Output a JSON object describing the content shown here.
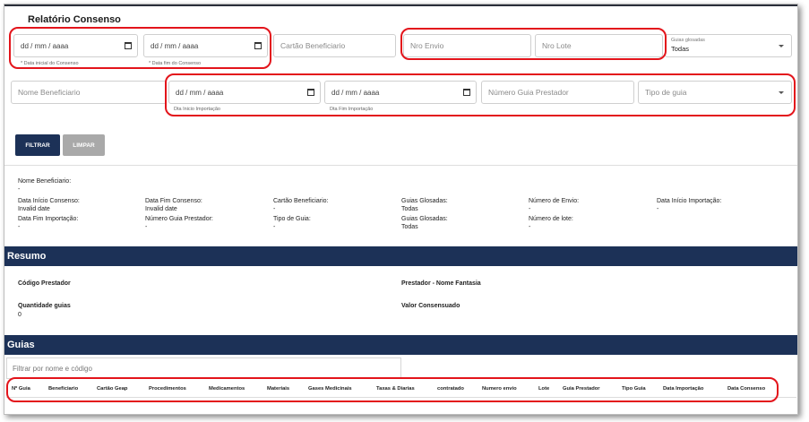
{
  "page": {
    "title": "Relatório Consenso"
  },
  "filters": {
    "data_inicial_consenso": {
      "value": "dd / mm / aaaa",
      "helper": "* Data inicial do Consenso"
    },
    "data_fim_consenso": {
      "value": "dd / mm / aaaa",
      "helper": "* Data fim do Consenso"
    },
    "cartao_beneficiario": {
      "placeholder": "Cartão Beneficiario"
    },
    "nro_envio": {
      "placeholder": "Nro Envio"
    },
    "nro_lote": {
      "placeholder": "Nro Lote"
    },
    "guias_glosadas": {
      "label": "Guias glosadas",
      "value": "Todas"
    },
    "nome_beneficiario": {
      "placeholder": "Nome Beneficiario"
    },
    "data_inicio_importacao": {
      "value": "dd / mm / aaaa",
      "helper": "Dta Inicio Importação"
    },
    "data_fim_importacao": {
      "value": "dd / mm / aaaa",
      "helper": "Dta Fim Importação"
    },
    "numero_guia_prestador": {
      "placeholder": "Número Guia Prestador"
    },
    "tipo_de_guia": {
      "placeholder": "Tipo de guia"
    }
  },
  "actions": {
    "filtrar": "FILTRAR",
    "limpar": "LIMPAR"
  },
  "filter_summary": {
    "nome_beneficiario_label": "Nome Beneficiario:",
    "nome_beneficiario_value": "-",
    "row1": [
      {
        "label": "Data Início Consenso:",
        "value": "Invalid date"
      },
      {
        "label": "Data Fim Consenso:",
        "value": "Invalid date"
      },
      {
        "label": "Cartão Beneficiario:",
        "value": "-"
      },
      {
        "label": "Guias Glosadas:",
        "value": "Todas"
      },
      {
        "label": "Número de Envio:",
        "value": "-"
      },
      {
        "label": "Data Início Importação:",
        "value": "-"
      }
    ],
    "row2": [
      {
        "label": "Data Fim Importação:",
        "value": "-"
      },
      {
        "label": "Número Guia Prestador:",
        "value": "-"
      },
      {
        "label": "Tipo de Guia:",
        "value": "-"
      },
      {
        "label": "Guias Glosadas:",
        "value": "Todas"
      },
      {
        "label": "Número de lote:",
        "value": "-"
      }
    ]
  },
  "resumo": {
    "title": "Resumo",
    "codigo_prestador_label": "Código Prestador",
    "prestador_nome_label": "Prestador - Nome Fantasia",
    "quantidade_guias_label": "Quantidade guias",
    "quantidade_guias_value": "0",
    "valor_consensuado_label": "Valor Consensuado"
  },
  "guias": {
    "title": "Guias",
    "filter_placeholder": "Filtrar por nome e código",
    "columns": [
      "Nº Guia",
      "Beneficiario",
      "Cartão Geap",
      "Procedimentos",
      "Medicamentos",
      "Materiais",
      "Gases Medicinais",
      "Taxas & Diarias",
      "contratado",
      "Numero envio",
      "Lote",
      "Guia Prestador",
      "Tipo Guia",
      "Data Importação",
      "Data Consenso"
    ]
  },
  "colors": {
    "primary": "#1c3157",
    "disabled": "#a9a9a9",
    "highlight": "#e3141b"
  }
}
